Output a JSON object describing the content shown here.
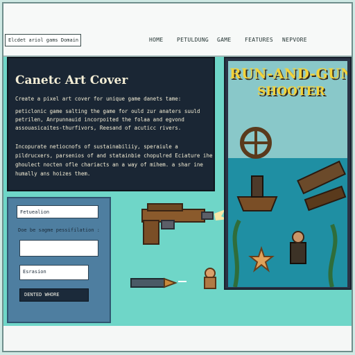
{
  "header": {
    "brand": "Elcdet ariol gams Domain",
    "nav": [
      "HOME",
      "PETULDUNG",
      "GAME",
      "FEATURES",
      "NEPVORE"
    ]
  },
  "intro_panel": {
    "title": "Canetc Art Cover",
    "intro": "Create a pixel art cover for unique game danets tame:",
    "para1": "peticlonic game salting the game for ould zur anaters suuld petrilen, Anrpunnauid incorpoited the folaa and egvond assouasicaites-thurfivors, Reesand of acuticc rivers.",
    "para2": "Incopurate netiocnofs of sustainabiliiy, speraiule a pildrucxers, parsenios of and statainbie chopulred Eciature ihe ghoulect nocten ofle chariacts an a way of mihem. a shar ine humally ans hoizes them."
  },
  "form": {
    "label1": "Fetuealion",
    "label2": "Doe be sagme pessifilation :",
    "label3": "Esrasion",
    "submit": "DENTED WHORE"
  },
  "cover": {
    "title_line1": "RUN-AND-GUN",
    "title_line2": "SHOOTER"
  },
  "colors": {
    "background": "#6fd6c8",
    "panel_dark": "#1a2634",
    "form_panel": "#4e7ea0",
    "title_yellow": "#f2d23a"
  }
}
